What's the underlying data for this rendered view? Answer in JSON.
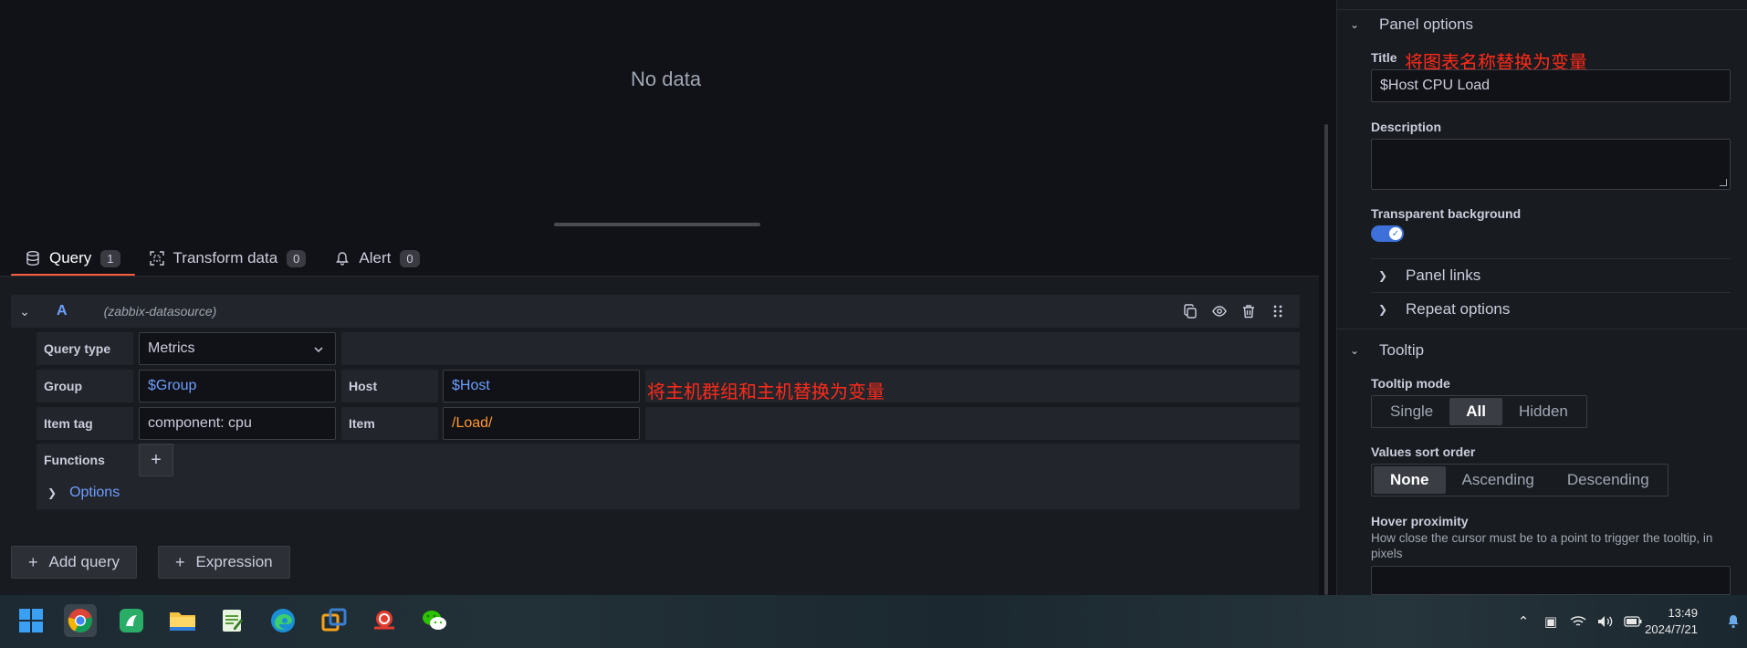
{
  "panel": {
    "no_data": "No data"
  },
  "tabs": [
    {
      "label": "Query",
      "count": "1"
    },
    {
      "label": "Transform data",
      "count": "0"
    },
    {
      "label": "Alert",
      "count": "0"
    }
  ],
  "query": {
    "ref_id": "A",
    "datasource": "(zabbix-datasource)",
    "query_type_label": "Query type",
    "query_type_value": "Metrics",
    "group_label": "Group",
    "group_value": "$Group",
    "host_label": "Host",
    "host_value": "$Host",
    "item_tag_label": "Item tag",
    "item_tag_value": "component: cpu",
    "item_label": "Item",
    "item_value": "/Load/",
    "functions_label": "Functions",
    "functions_add": "+",
    "options_label": "Options"
  },
  "buttons": {
    "add_query": "Add query",
    "expression": "Expression"
  },
  "annotations": {
    "title_note": "将图表名称替换为变量",
    "host_note": "将主机群组和主机替换为变量"
  },
  "options": {
    "panel_options_heading": "Panel options",
    "title_label": "Title",
    "title_value": "$Host CPU Load",
    "description_label": "Description",
    "description_value": "",
    "transparent_label": "Transparent background",
    "transparent_on": true,
    "panel_links": "Panel links",
    "repeat_options": "Repeat options",
    "tooltip_heading": "Tooltip",
    "tooltip_mode_label": "Tooltip mode",
    "tooltip_modes": [
      "Single",
      "All",
      "Hidden"
    ],
    "tooltip_mode_selected": "All",
    "sort_label": "Values sort order",
    "sort_options": [
      "None",
      "Ascending",
      "Descending"
    ],
    "sort_selected": "None",
    "hover_label": "Hover proximity",
    "hover_desc": "How close the cursor must be to a point to trigger the tooltip, in pixels"
  },
  "taskbar": {
    "apps": [
      "windows-start",
      "chrome",
      "wechat-work",
      "file-explorer",
      "notepad",
      "edge",
      "vmware",
      "snail-app",
      "wechat"
    ],
    "clock_time": "13:49",
    "clock_date": "2024/7/21"
  },
  "colors": {
    "accent_tab": "#f55f3e",
    "link_blue": "#6e9fff",
    "item_orange": "#ff9830",
    "annotation_red": "#ff2a1a",
    "toggle_blue": "#3d71d9"
  }
}
